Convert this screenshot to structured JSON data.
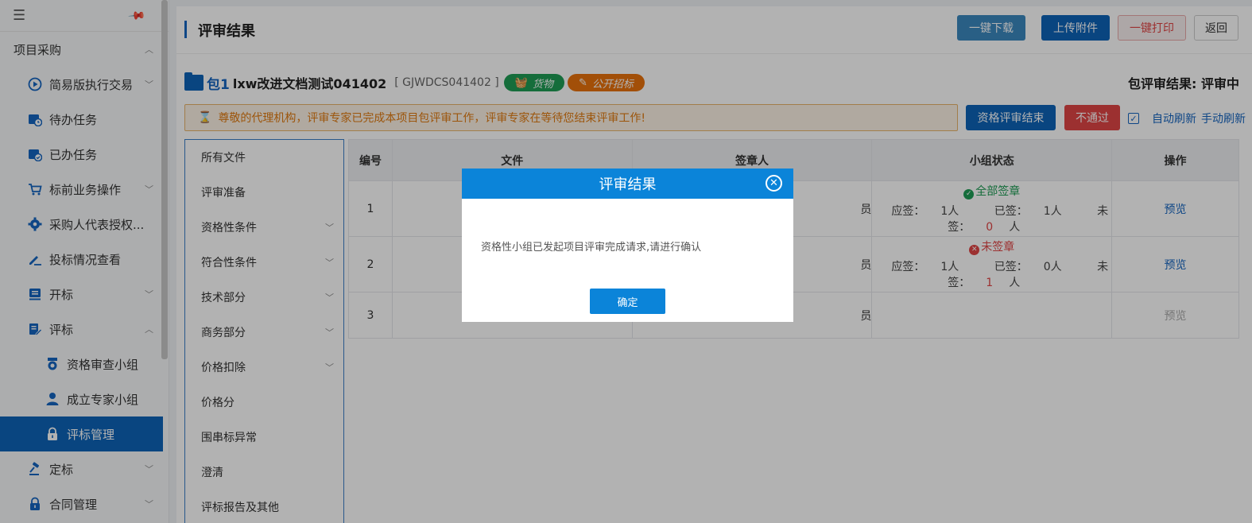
{
  "sidebar": {
    "group_top": "项目采购",
    "items": [
      {
        "label": "简易版执行交易",
        "icon": "play-circle-icon",
        "chevron": true
      },
      {
        "label": "待办任务",
        "icon": "calendar-clock-icon",
        "chevron": false
      },
      {
        "label": "已办任务",
        "icon": "calendar-check-icon",
        "chevron": false
      },
      {
        "label": "标前业务操作",
        "icon": "cart-icon",
        "chevron": true
      },
      {
        "label": "采购人代表授权...",
        "icon": "gear-icon",
        "chevron": false
      },
      {
        "label": "投标情况查看",
        "icon": "pen-icon",
        "chevron": false
      },
      {
        "label": "开标",
        "icon": "book-icon",
        "chevron": true
      },
      {
        "label": "评标",
        "icon": "edit-doc-icon",
        "chevron": true
      }
    ],
    "subitems": [
      {
        "label": "资格审查小组",
        "icon": "badge-icon"
      },
      {
        "label": "成立专家小组",
        "icon": "user-icon"
      },
      {
        "label": "评标管理",
        "icon": "lock-icon"
      }
    ],
    "bottom_items": [
      {
        "label": "定标",
        "icon": "gavel-icon"
      },
      {
        "label": "合同管理",
        "icon": "lock-icon"
      }
    ]
  },
  "header": {
    "title": "评审结果",
    "download_label": "一键下载",
    "upload_label": "上传附件",
    "print_label": "一键打印",
    "back_label": "返回"
  },
  "package": {
    "no": "包1",
    "name": "lxw改进文档测试041402",
    "code": "[ GJWDCS041402 ]",
    "tag_goods": "货物",
    "tag_bid": "公开招标",
    "result_label": "包评审结果:",
    "result_value": "评审中"
  },
  "notice": {
    "text": "尊敬的代理机构，评审专家已完成本项目包评审工作，评审专家在等待您结束评审工作!"
  },
  "actions": {
    "qual_end_label": "资格评审结束",
    "reject_label": "不通过",
    "auto_refresh_label": "自动刷新",
    "manual_refresh_label": "手动刷新"
  },
  "left_nav": [
    {
      "label": "所有文件",
      "chevron": false
    },
    {
      "label": "评审准备",
      "chevron": false
    },
    {
      "label": "资格性条件",
      "chevron": true
    },
    {
      "label": "符合性条件",
      "chevron": true
    },
    {
      "label": "技术部分",
      "chevron": true
    },
    {
      "label": "商务部分",
      "chevron": true
    },
    {
      "label": "价格扣除",
      "chevron": true
    },
    {
      "label": "价格分",
      "chevron": false
    },
    {
      "label": "围串标异常",
      "chevron": false
    },
    {
      "label": "澄清",
      "chevron": false
    },
    {
      "label": "评标报告及其他",
      "chevron": false
    }
  ],
  "table": {
    "headers": [
      "编号",
      "文件",
      "签章人",
      "小组状态",
      "操作"
    ],
    "rows": [
      {
        "no": "1",
        "signer_tail": "员",
        "status": "全部签章",
        "status_type": "ok",
        "due_label": "应签：",
        "due": "1人",
        "signed_label": "已签：",
        "signed": "1人",
        "unsigned_label": "未签：",
        "unsigned_num": "0",
        "unsigned_unit": "人",
        "action": "预览",
        "action_enabled": true
      },
      {
        "no": "2",
        "signer_tail": "员",
        "status": "未签章",
        "status_type": "no",
        "due_label": "应签：",
        "due": "1人",
        "signed_label": "已签：",
        "signed": "0人",
        "unsigned_label": "未签：",
        "unsigned_num": "1",
        "unsigned_unit": "人",
        "action": "预览",
        "action_enabled": true
      },
      {
        "no": "3",
        "signer_tail": "员",
        "status": "",
        "status_type": "",
        "action": "预览",
        "action_enabled": false
      }
    ]
  },
  "modal": {
    "title": "评审结果",
    "message": "资格性小组已发起项目评审完成请求,请进行确认",
    "ok_label": "确定"
  }
}
